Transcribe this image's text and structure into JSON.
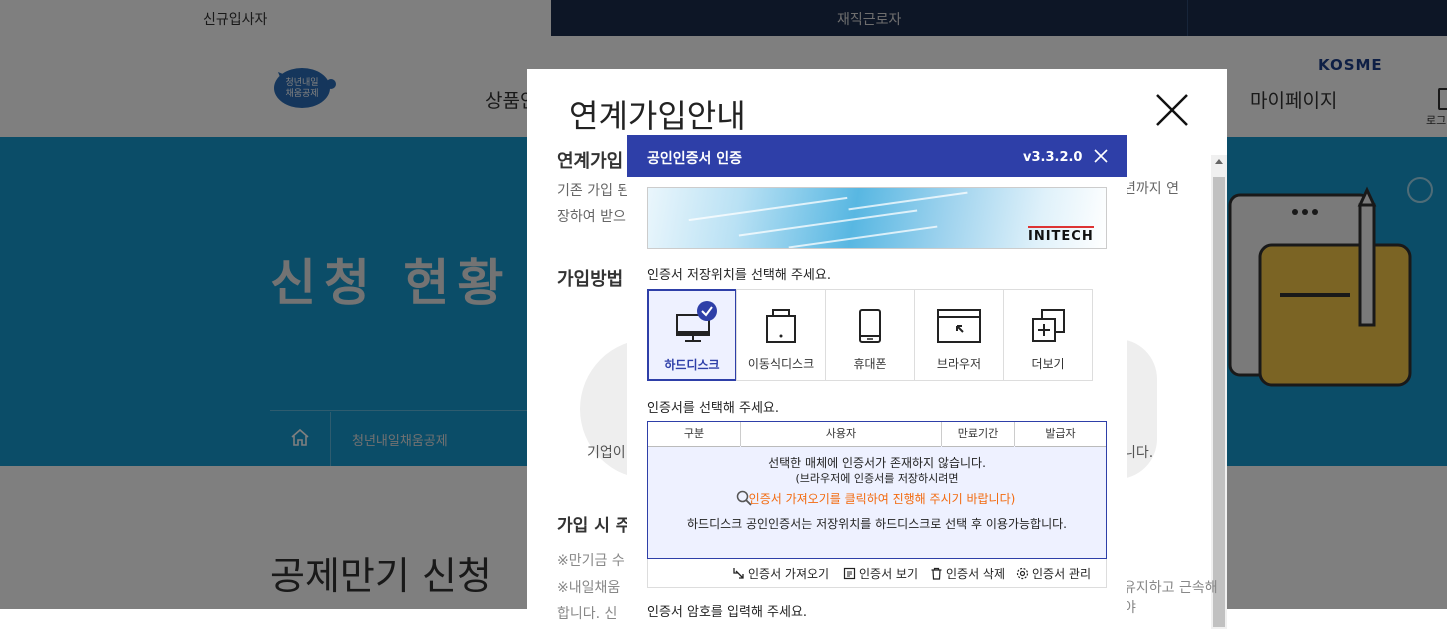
{
  "topbar": {
    "tab_new": "신규입사자",
    "tab_current": "재직근로자"
  },
  "header": {
    "logo_text": "청년내일채움공제",
    "nav_partial": "상품안",
    "nav_mypage": "마이페이지",
    "login_label": "로그",
    "kosme_logo": "KOSME"
  },
  "banner": {
    "title": "신청 현황 관",
    "breadcrumb": "청년내일채움공제"
  },
  "content_title": "공제만기 신청",
  "modal_mid": {
    "title": "연계가입안내",
    "heading1": "연계가입",
    "para1_l1": "기존 가입 된",
    "para1_l2": "장하여 받으",
    "para1_right": "년까지 연",
    "heading2": "가입방법",
    "para2": "기업이",
    "para2_right": "니다.",
    "heading3": "가입 시 주",
    "note1": "※만기금 수",
    "note2": "※내일채움",
    "note2_right": "유지하고 근속해야",
    "note3": "합니다. 신",
    "note3_right": "능합니다"
  },
  "cert": {
    "title": "공인인증서 인증",
    "version": "v3.3.2.0",
    "banner_logo": "INITECH",
    "location_prompt": "인증서 저장위치를 선택해 주세요.",
    "locations": [
      {
        "label": "하드디스크",
        "icon": "hard-disk-icon",
        "selected": true
      },
      {
        "label": "이동식디스크",
        "icon": "removable-disk-icon",
        "selected": false
      },
      {
        "label": "휴대폰",
        "icon": "phone-icon",
        "selected": false
      },
      {
        "label": "브라우저",
        "icon": "browser-icon",
        "selected": false
      },
      {
        "label": "더보기",
        "icon": "more-icon",
        "selected": false
      }
    ],
    "cert_prompt": "인증서를 선택해 주세요.",
    "table_headers": [
      "구분",
      "사용자",
      "만료기간",
      "발급자"
    ],
    "empty_msg1": "선택한 매체에 인증서가 존재하지 않습니다.",
    "empty_msg2": "(브라우저에 인증서를 저장하시려면",
    "empty_msg3": "인증서 가져오기를 클릭하여 진행해 주시기 바랍니다)",
    "empty_msg4": "하드디스크 공인인증서는 저장위치를 하드디스크로 선택 후 이용가능합니다.",
    "actions": [
      "인증서 가져오기",
      "인증서 보기",
      "인증서 삭제",
      "인증서 관리"
    ],
    "password_prompt": "인증서 암호를 입력해 주세요.",
    "accent_color": "#2e3fa8",
    "highlight_color": "#f26a0f"
  }
}
